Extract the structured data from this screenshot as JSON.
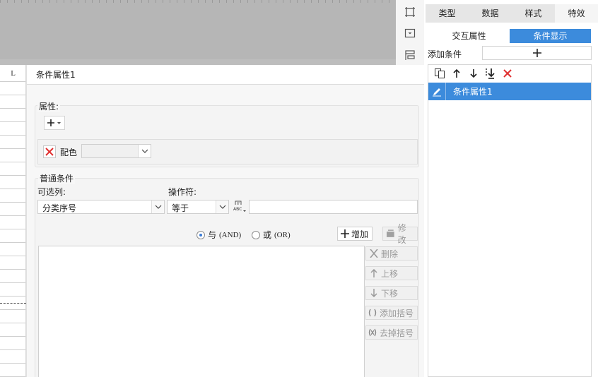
{
  "sheet": {
    "column_header": "L"
  },
  "dialog": {
    "title": "条件属性1",
    "attributes": {
      "legend": "属性:",
      "color_label": "配色"
    },
    "normal": {
      "legend": "普通条件",
      "column_label": "可选列:",
      "column_value": "分类序号",
      "operator_label": "操作符:",
      "operator_value": "等于",
      "value_input": "",
      "and_label": "与",
      "and_tag": "(AND)",
      "or_label": "或",
      "or_tag": "(OR)",
      "logic_selected": "AND"
    },
    "buttons": {
      "add": "增加",
      "modify": "修改",
      "delete": "删除",
      "move_up": "上移",
      "move_down": "下移",
      "add_bracket": "添加括号",
      "remove_bracket": "去掉括号"
    }
  },
  "panel": {
    "tabs": [
      "类型",
      "数据",
      "样式",
      "特效"
    ],
    "active_tab": "特效",
    "subtabs": [
      "交互属性",
      "条件显示"
    ],
    "active_subtab": "条件显示",
    "add_condition_label": "添加条件",
    "conditions": [
      "条件属性1"
    ],
    "accent_color": "#3c8bdc"
  }
}
